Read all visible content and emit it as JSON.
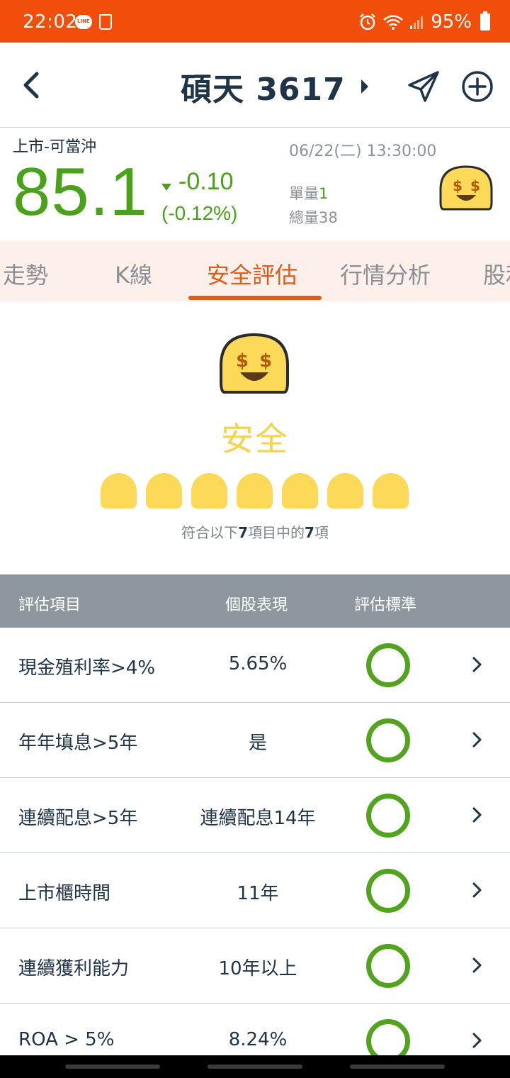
{
  "status_bar": {
    "time": "22:02",
    "battery": "95%",
    "icons": [
      "line-icon",
      "cup-icon",
      "alarm-icon",
      "wifi-icon",
      "signal-icon",
      "battery-icon"
    ]
  },
  "header": {
    "title": "碩天 3617",
    "icons": [
      "back-icon",
      "caret-right-icon",
      "share-icon",
      "add-icon"
    ]
  },
  "quote": {
    "market_tag": "上市-可當沖",
    "price": "85.1",
    "change": "-0.10",
    "change_pct": "(-0.12%)",
    "datetime": "06/22(二) 13:30:00",
    "single_volume_label": "單量",
    "single_volume": "1",
    "total_volume_label": "總量",
    "total_volume": "38",
    "status_icon": "money-eyes-face-icon",
    "color_down": "#4aa11a"
  },
  "tabs": {
    "items": [
      "走勢",
      "K線",
      "安全評估",
      "行情分析",
      "股利"
    ],
    "active": "安全評估",
    "accent": "#e25b18"
  },
  "safety": {
    "icon": "money-eyes-face-icon",
    "label": "安全",
    "summary_prefix": "符合以下",
    "summary_total": "7",
    "summary_mid": "項目中的",
    "summary_passed": "7",
    "summary_suffix": "項",
    "passed_count": 7,
    "total_count": 7,
    "accent": "#fdd95a"
  },
  "table": {
    "headers": [
      "評估項目",
      "個股表現",
      "評估標準"
    ],
    "rows": [
      {
        "item": "現金殖利率>4%",
        "value": "5.65%",
        "result": "pass"
      },
      {
        "item": "年年填息>5年",
        "value": "是",
        "result": "pass"
      },
      {
        "item": "連續配息>5年",
        "value": "連續配息14年",
        "result": "pass"
      },
      {
        "item": "上市櫃時間",
        "value": "11年",
        "result": "pass"
      },
      {
        "item": "連續獲利能力",
        "value": "10年以上",
        "result": "pass"
      },
      {
        "item": "ROA > 5%",
        "value": "8.24%",
        "result": "pass"
      }
    ],
    "pass_color": "#52a31d",
    "header_bg": "#8e979f"
  }
}
